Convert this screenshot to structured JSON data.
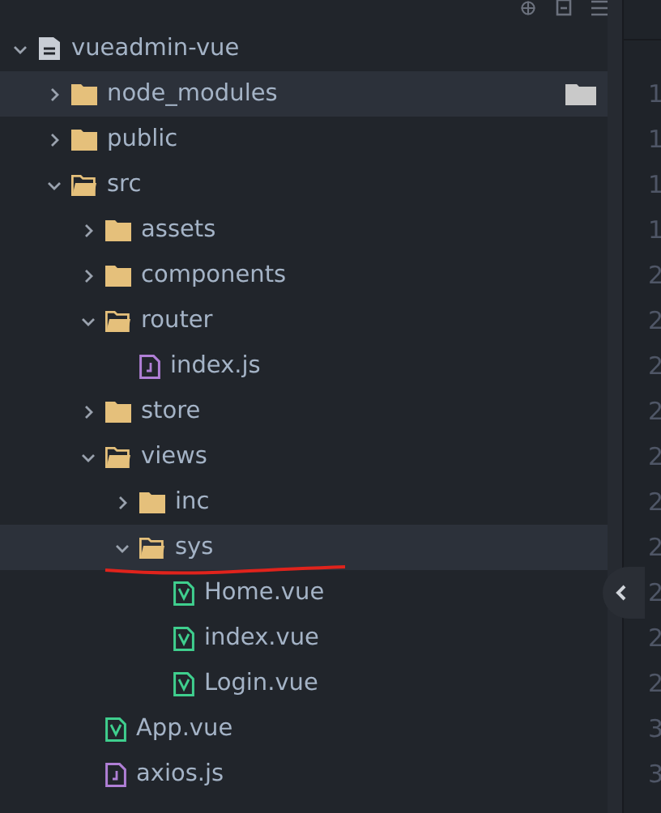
{
  "tree": [
    {
      "kind": "repo",
      "name": "vueadmin-vue",
      "expanded": true,
      "highlighted": false,
      "children": [
        {
          "kind": "folder",
          "name": "node_modules",
          "expanded": false,
          "highlighted": true,
          "badge": true
        },
        {
          "kind": "folder",
          "name": "public",
          "expanded": false,
          "highlighted": false
        },
        {
          "kind": "folder",
          "name": "src",
          "expanded": true,
          "highlighted": false,
          "children": [
            {
              "kind": "folder",
              "name": "assets",
              "expanded": false,
              "highlighted": false
            },
            {
              "kind": "folder",
              "name": "components",
              "expanded": false,
              "highlighted": false
            },
            {
              "kind": "folder",
              "name": "router",
              "expanded": true,
              "highlighted": false,
              "children": [
                {
                  "kind": "js",
                  "name": "index.js",
                  "highlighted": false
                }
              ]
            },
            {
              "kind": "folder",
              "name": "store",
              "expanded": false,
              "highlighted": false
            },
            {
              "kind": "folder",
              "name": "views",
              "expanded": true,
              "highlighted": false,
              "children": [
                {
                  "kind": "folder",
                  "name": "inc",
                  "expanded": false,
                  "highlighted": false
                },
                {
                  "kind": "folder",
                  "name": "sys",
                  "expanded": true,
                  "highlighted": true,
                  "underlined": true,
                  "children": [
                    {
                      "kind": "vue",
                      "name": "Home.vue",
                      "highlighted": false
                    },
                    {
                      "kind": "vue",
                      "name": "index.vue",
                      "highlighted": false
                    },
                    {
                      "kind": "vue",
                      "name": "Login.vue",
                      "highlighted": false
                    }
                  ]
                }
              ]
            },
            {
              "kind": "vue",
              "name": "App.vue",
              "highlighted": false
            },
            {
              "kind": "js",
              "name": "axios.js",
              "highlighted": false
            }
          ]
        }
      ]
    }
  ],
  "gutter": [
    "1",
    "1",
    "1",
    "1",
    "2",
    "2",
    "2",
    "2",
    "2",
    "2",
    "2",
    "2",
    "2",
    "2",
    "3",
    "3"
  ]
}
